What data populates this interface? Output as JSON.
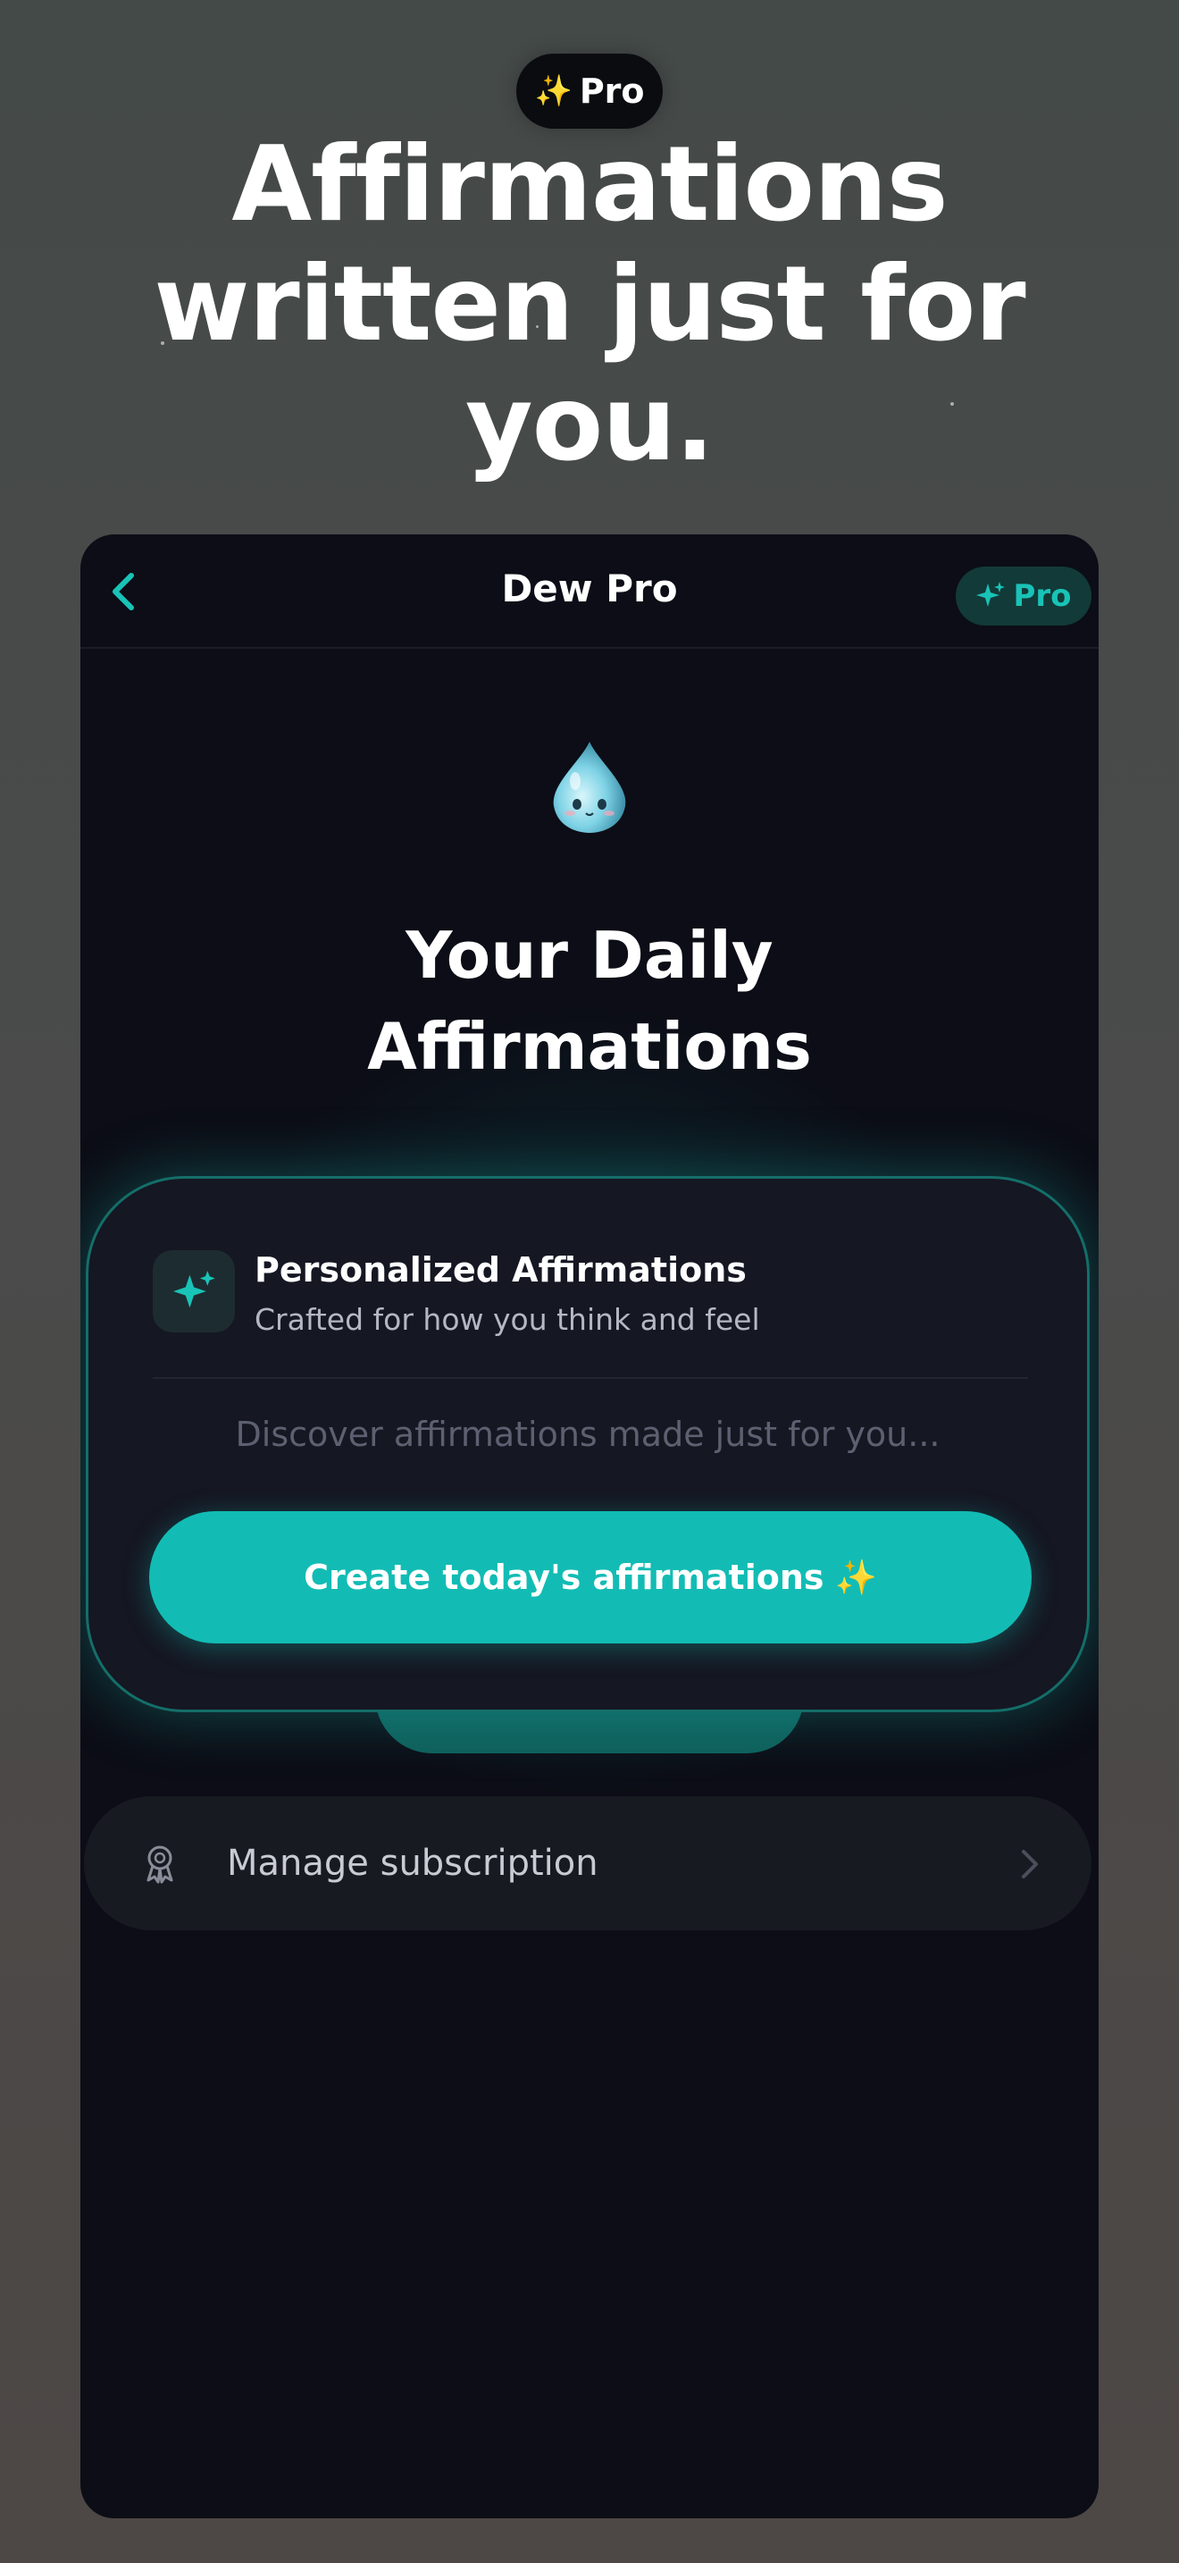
{
  "promo": {
    "badge_icon": "sparkles-icon",
    "badge_label": "Pro",
    "headline": "Affirmations written just for you."
  },
  "navbar": {
    "back_icon": "chevron-left-icon",
    "title": "Dew Pro",
    "pro_badge_icon": "sparkles-icon",
    "pro_badge_label": "Pro"
  },
  "hero": {
    "mascot_icon": "water-drop-mascot-icon",
    "title_line1": "Your Daily",
    "title_line2": "Affirmations"
  },
  "feature_card": {
    "icon": "sparkles-icon",
    "title": "Personalized Affirmations",
    "subtitle": "Crafted for how you think and feel",
    "placeholder": "Discover affirmations made just for you...",
    "button_label": "Create today's affirmations",
    "button_emoji": "✨"
  },
  "subscription": {
    "icon": "award-ribbon-icon",
    "label": "Manage subscription",
    "chevron_icon": "chevron-right-icon"
  },
  "colors": {
    "accent": "#12bcb4",
    "background": "#0c0d16",
    "spark": "#f4c542"
  }
}
